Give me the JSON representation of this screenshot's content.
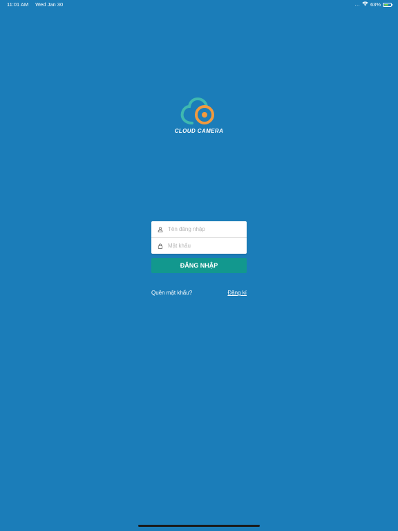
{
  "status_bar": {
    "time": "11:01 AM",
    "date": "Wed Jan 30",
    "dots": "...",
    "battery_percent": "63%",
    "battery_level": 0.63,
    "battery_color": "#7ddc4a"
  },
  "logo": {
    "text": "CLOUD CAMERA",
    "cloud_color": "#3fb8b0",
    "lens_color": "#f19a3e"
  },
  "login_form": {
    "username_placeholder": "Tên đăng nhập",
    "username_value": "",
    "password_placeholder": "Mật khẩu",
    "password_value": "",
    "username_icon": "user-icon",
    "password_icon": "lock-icon"
  },
  "actions": {
    "login_label": "ĐĂNG NHẬP",
    "forgot_password": "Quên mật khẩu?",
    "register": "Đăng kí"
  },
  "colors": {
    "background": "#1b7db9",
    "button": "#12988e"
  }
}
